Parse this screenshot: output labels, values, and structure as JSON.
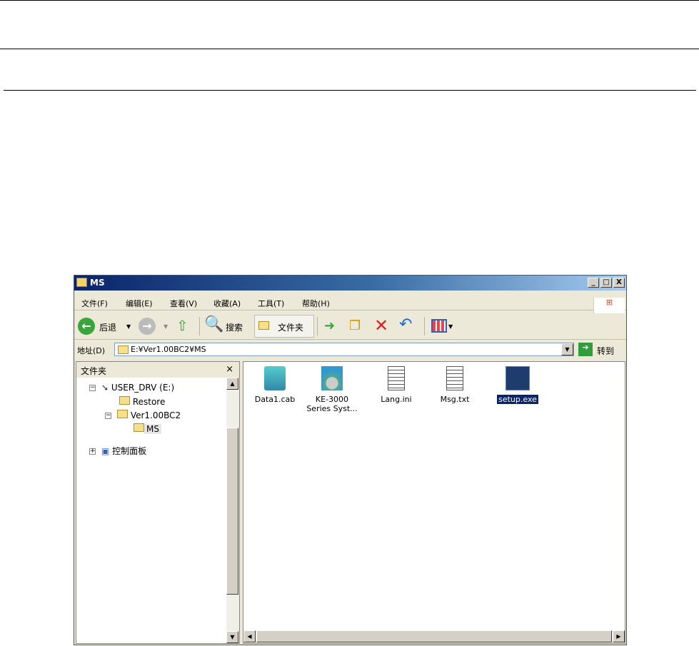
{
  "window": {
    "title": "MS",
    "min": "_",
    "max": "□",
    "close": "X"
  },
  "menu": [
    "文件(F)",
    "编辑(E)",
    "查看(V)",
    "收藏(A)",
    "工具(T)",
    "帮助(H)"
  ],
  "toolbar": {
    "back": "后退",
    "search": "搜索",
    "folders": "文件夹"
  },
  "address": {
    "label": "地址(D)",
    "value": "E:¥Ver1.00BC2¥MS",
    "go": "转到"
  },
  "folders_pane": {
    "title": "文件夹",
    "close": "×",
    "tree": [
      {
        "label": "USER_DRV (E:)",
        "expander": "−"
      },
      {
        "label": "Restore"
      },
      {
        "label": "Ver1.00BC2",
        "expander": "−"
      },
      {
        "label": "MS"
      },
      {
        "label": "控制面板",
        "expander": "+"
      }
    ]
  },
  "files": [
    {
      "name": "Data1.cab"
    },
    {
      "name": "KE-3000 Series Syst..."
    },
    {
      "name": "Lang.ini"
    },
    {
      "name": "Msg.txt"
    },
    {
      "name": "setup.exe",
      "selected": true
    }
  ]
}
